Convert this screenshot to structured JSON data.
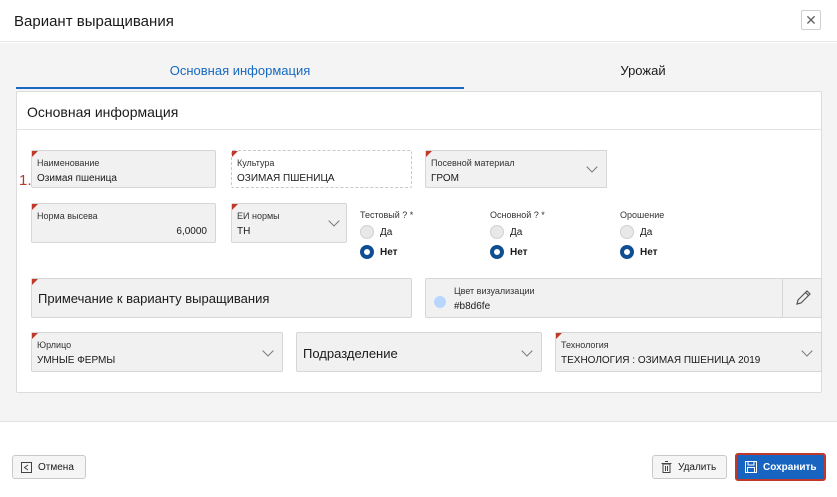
{
  "dialog": {
    "title": "Вариант выращивания",
    "close_glyph": "✕"
  },
  "tabs": [
    {
      "label": "Основная информация",
      "active": true
    },
    {
      "label": "Урожай",
      "active": false
    }
  ],
  "panel": {
    "title": "Основная информация"
  },
  "marker": "1.",
  "fields": {
    "name": {
      "label": "Наименование",
      "value": "Озимая пшеница",
      "required": true
    },
    "culture": {
      "label": "Культура",
      "value": "ОЗИМАЯ ПШЕНИЦА",
      "required": true
    },
    "seed": {
      "label": "Посевной материал",
      "value": "ГРОМ",
      "required": true
    },
    "seeding_rate": {
      "label": "Норма высева",
      "value": "6,0000",
      "required": true
    },
    "unit": {
      "label": "ЕИ нормы",
      "value": "ТН",
      "required": true
    },
    "note": {
      "placeholder": "Примечание к варианту выращивания",
      "required": true
    },
    "color": {
      "label": "Цвет визуализации",
      "value": "#b8d6fe"
    },
    "legal": {
      "label": "Юрлицо",
      "value": "УМНЫЕ ФЕРМЫ",
      "required": true
    },
    "division": {
      "placeholder": "Подразделение"
    },
    "tech": {
      "label": "Технология",
      "value": "ТЕХНОЛОГИЯ : ОЗИМАЯ ПШЕНИЦА 2019",
      "required": true
    }
  },
  "radios": {
    "test": {
      "label": "Тестовый ? *",
      "yes": "Да",
      "no": "Нет",
      "selected": "no"
    },
    "main": {
      "label": "Основной ? *",
      "yes": "Да",
      "no": "Нет",
      "selected": "no"
    },
    "irrigation": {
      "label": "Орошение",
      "yes": "Да",
      "no": "Нет",
      "selected": "no"
    }
  },
  "footer": {
    "cancel": "Отмена",
    "delete": "Удалить",
    "save": "Сохранить"
  },
  "colors": {
    "accent": "#1769c2",
    "save_bg": "#1865c1",
    "highlight": "#c0392b",
    "radio_on": "#0f4e91"
  }
}
